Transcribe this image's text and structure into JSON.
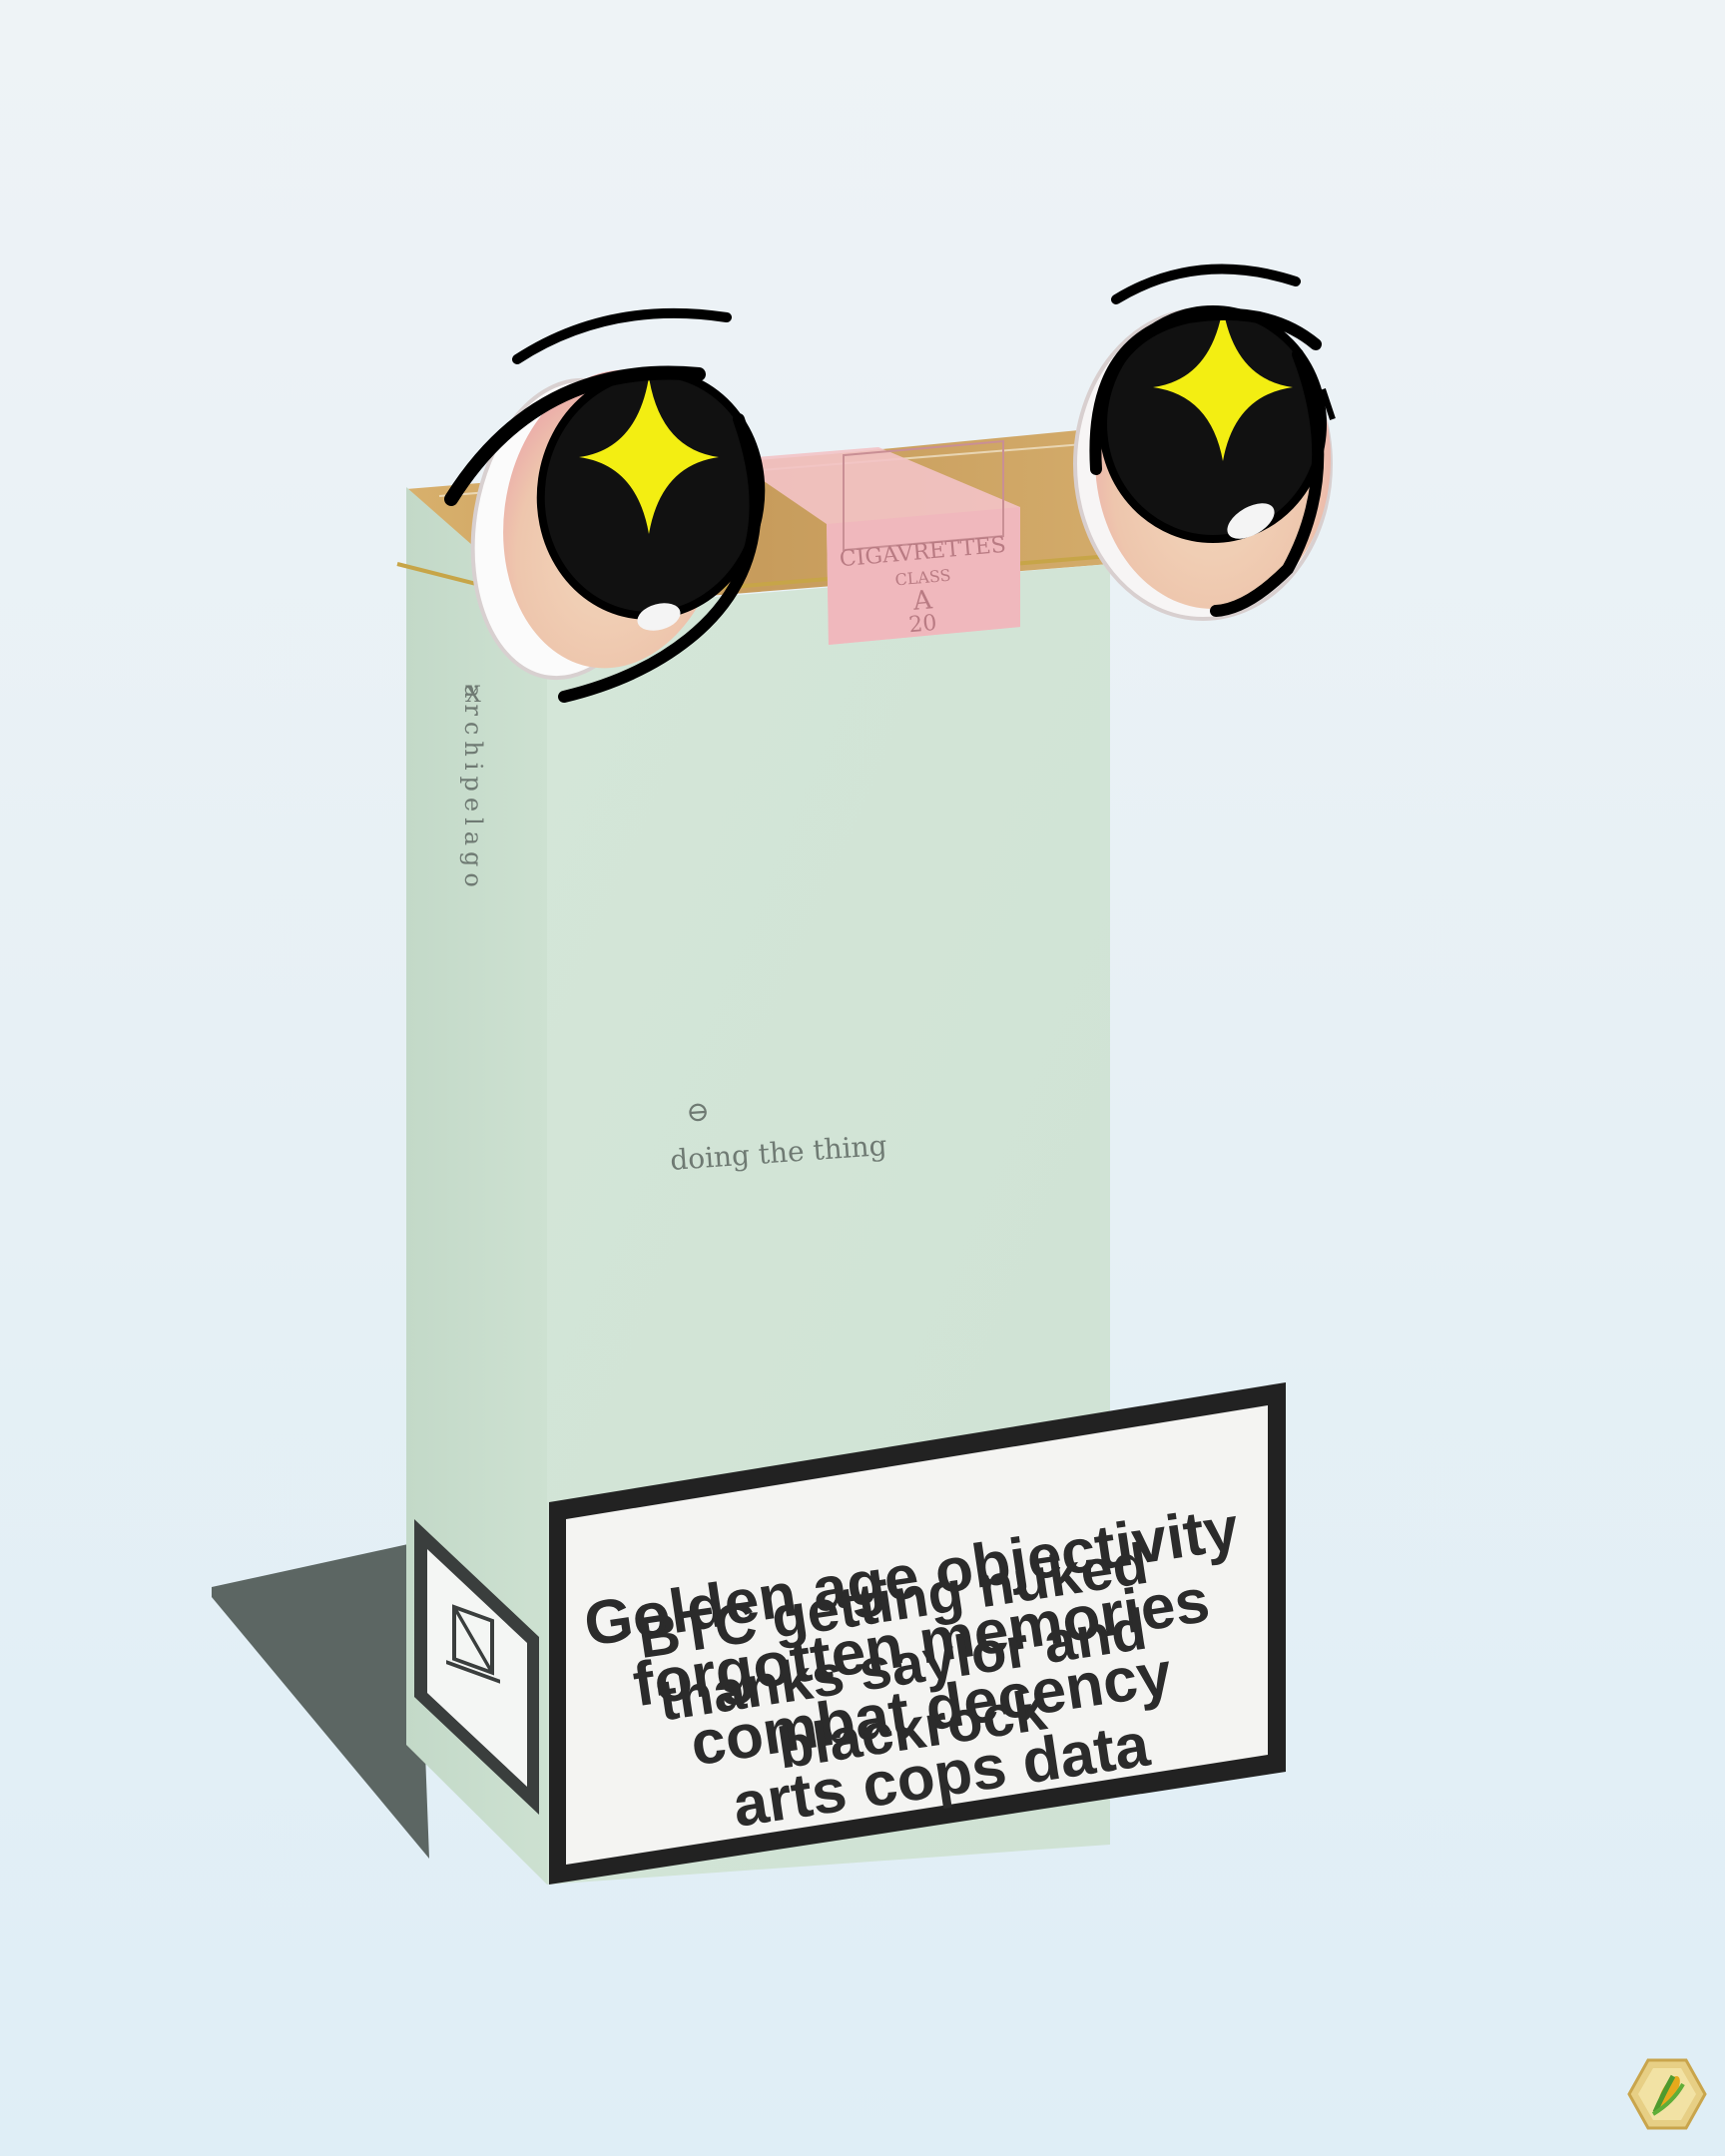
{
  "pack": {
    "side_mark": "X",
    "brand": "archipelago",
    "front_symbol": "⊖",
    "tagline": "doing the thing"
  },
  "stamp": {
    "arc_text": "CIGAVRETTES",
    "class": "CLASS",
    "letter": "A",
    "count": "20"
  },
  "warning": {
    "layer1": [
      "Golden age objectivity",
      "forgotten memories",
      "combat decency",
      "arts cops data"
    ],
    "layer2": [
      "BTC getting nuked",
      "thanks saylor and",
      "blackrock"
    ]
  },
  "colors": {
    "pack_front": "#d2e4d6",
    "pack_side": "#c6dccb",
    "foil": "#c9a46a",
    "stamp": "#f0c4c6",
    "star": "#f3ee12"
  },
  "icons": [
    "eye-icon",
    "sparkle-icon",
    "corn-badge-icon"
  ]
}
